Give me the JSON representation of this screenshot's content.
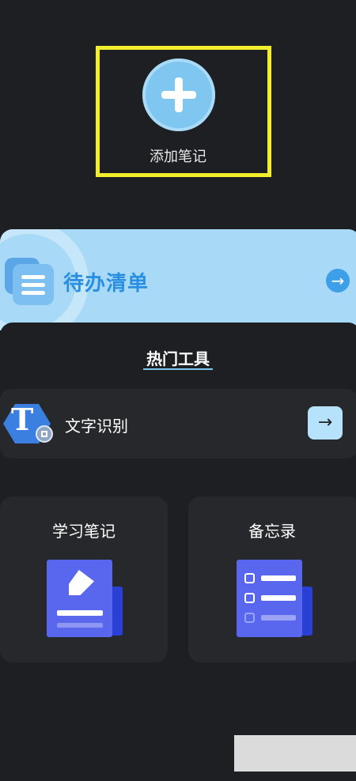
{
  "add_note": {
    "label": "添加笔记",
    "highlight_color": "#f2ee2c",
    "icon": "plus-circle-icon"
  },
  "todo": {
    "title": "待办清单",
    "icon": "list-icon",
    "arrow": "→",
    "accent": "#a8d9f7"
  },
  "hot_tools": {
    "heading": "热门工具",
    "ocr": {
      "label": "文字识别",
      "icon_letter": "T",
      "arrow": "→"
    },
    "cards": [
      {
        "title": "学习笔记",
        "icon": "note-edit-icon"
      },
      {
        "title": "备忘录",
        "icon": "checklist-icon"
      }
    ]
  }
}
